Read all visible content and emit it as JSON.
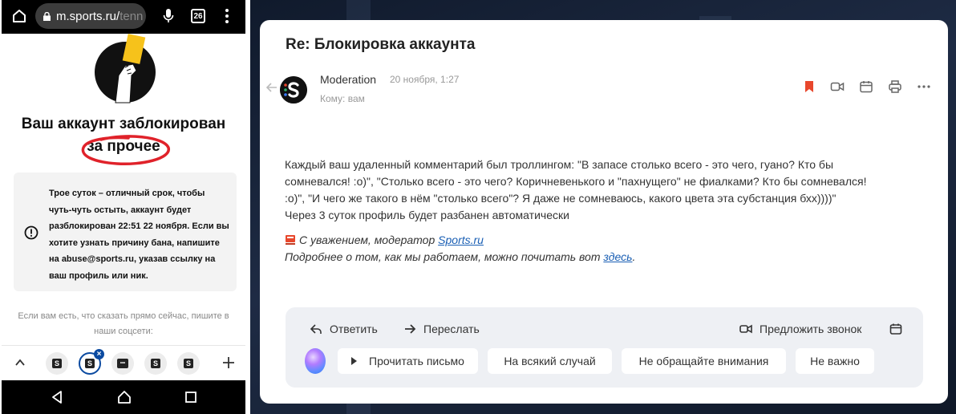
{
  "phone": {
    "url_domain": "m.sports.ru/",
    "url_rest": "tenn",
    "tab_count": "26",
    "title": "Ваш аккаунт заблокирован",
    "subtitle": "за прочее",
    "notice": "Трое суток – отличный срок, чтобы чуть-чуть остыть, аккаунт будет разблокирован 22:51 22 ноября. Если вы хотите узнать причину бана, напишите на abuse@sports.ru, указав ссылку на ваш профиль или ник.",
    "social_text": "Если вам есть, что сказать прямо сейчас, пишите в наши соцсети:",
    "tab_labels": [
      "S",
      "S",
      "•••",
      "S",
      "S"
    ],
    "close_mark": "×",
    "icons": [
      "home-icon",
      "lock-icon",
      "mic-icon",
      "tabs-icon",
      "menu-icon",
      "chevron-up-icon",
      "plus-icon",
      "back-icon",
      "home-nav-icon",
      "recents-icon"
    ]
  },
  "mail": {
    "subject": "Re: Блокировка аккаунта",
    "sender": "Moderation",
    "date": "20 ноября, 1:27",
    "to": "Кому: вам",
    "body_lines": [
      "Каждый ваш удаленный комментарий был троллингом: \"В запасе столько всего - это чего, гуано? Кто бы",
      "сомневался! :о)\", \"Столько всего - это чего? Коричневенького и \"пахнущего\" не фиалками? Кто бы сомневался!",
      ":о)\", \"И чего же такого в нём \"столько всего\"? Я даже не сомневаюсь, какого цвета эта субстанция бхх))))\"",
      "Через 3 суток профиль будет разбанен автоматически"
    ],
    "sig_prefix": "С уважением, модератор",
    "sig_link": "Sports.ru",
    "more_prefix": "Подробнее о том, как мы работаем, можно почитать вот",
    "more_link": "здесь",
    "more_suffix": ".",
    "reply_label": "Ответить",
    "forward_label": "Переслать",
    "call_label": "Предложить звонок",
    "chips": {
      "read": "Прочитать письмо",
      "just_in_case": "На всякий случай",
      "ignore": "Не обращайте внимания",
      "not_important": "Не важно"
    },
    "colors": {
      "accent": "#1a5fb4",
      "bookmark": "#e8472c",
      "reply_bg": "#eef0f4"
    },
    "icons": [
      "back-arrow-icon",
      "bookmark-icon",
      "video-call-icon",
      "calendar-icon",
      "print-icon",
      "more-icon",
      "reply-icon",
      "forward-icon",
      "video-icon",
      "calendar-small-icon",
      "alice-orb-icon",
      "flag-icon"
    ]
  }
}
